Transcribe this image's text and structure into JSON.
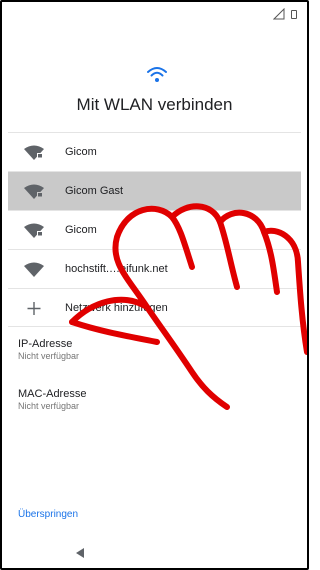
{
  "title": "Mit WLAN verbinden",
  "networks": [
    {
      "label": "Gicom",
      "locked": true,
      "selected": false
    },
    {
      "label": "Gicom Gast",
      "locked": true,
      "selected": true
    },
    {
      "label": "Gicom",
      "locked": true,
      "selected": false
    },
    {
      "label": "hochstift.…eifunk.net",
      "locked": false,
      "selected": false
    }
  ],
  "add_network": {
    "label": "Netzwerk hinzufügen",
    "icon": "plus-icon"
  },
  "ip": {
    "title": "IP-Adresse",
    "value": "Nicht verfügbar"
  },
  "mac": {
    "title": "MAC-Adresse",
    "value": "Nicht verfügbar"
  },
  "skip_label": "Überspringen",
  "colors": {
    "accent": "#1a73e8",
    "selected_row": "#c9c9c9",
    "hand_stroke": "#e00000"
  }
}
